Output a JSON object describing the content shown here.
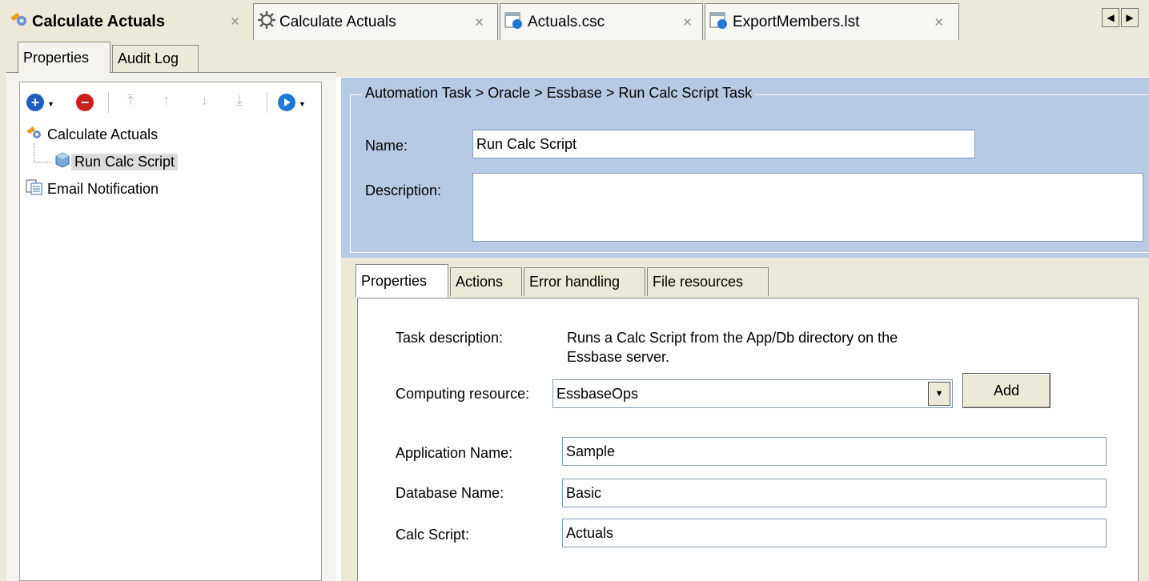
{
  "doc_tabs": [
    {
      "label": "Calculate Actuals",
      "close": "×"
    },
    {
      "label": "Calculate Actuals",
      "close": "×"
    },
    {
      "label": "Actuals.csc",
      "close": "×"
    },
    {
      "label": "ExportMembers.lst",
      "close": "×"
    }
  ],
  "left_tabs": [
    "Properties",
    "Audit Log"
  ],
  "tree": {
    "root": "Calculate Actuals",
    "child": "Run Calc Script",
    "sibling": "Email Notification"
  },
  "header": {
    "breadcrumb": "Automation Task > Oracle > Essbase > Run Calc Script Task",
    "name_label": "Name:",
    "name_value": "Run Calc Script",
    "description_label": "Description:",
    "description_value": ""
  },
  "inner_tabs": [
    "Properties",
    "Actions",
    "Error handling",
    "File resources"
  ],
  "properties": {
    "task_description_label": "Task description:",
    "task_description_line1": "Runs a Calc Script from the App/Db directory on the",
    "task_description_line2": "Essbase server.",
    "computing_resource_label": "Computing resource:",
    "computing_resource_value": "EssbaseOps",
    "add_button": "Add",
    "application_name_label": "Application Name:",
    "application_name_value": "Sample",
    "database_name_label": "Database Name:",
    "database_name_value": "Basic",
    "calc_script_label": "Calc Script:",
    "calc_script_value": "Actuals"
  },
  "colors": {
    "header_blue": "#b6c9e5",
    "window_bg": "#ece9d8",
    "add_icon": "#1f5fbf",
    "remove_icon": "#cc1f1f"
  }
}
